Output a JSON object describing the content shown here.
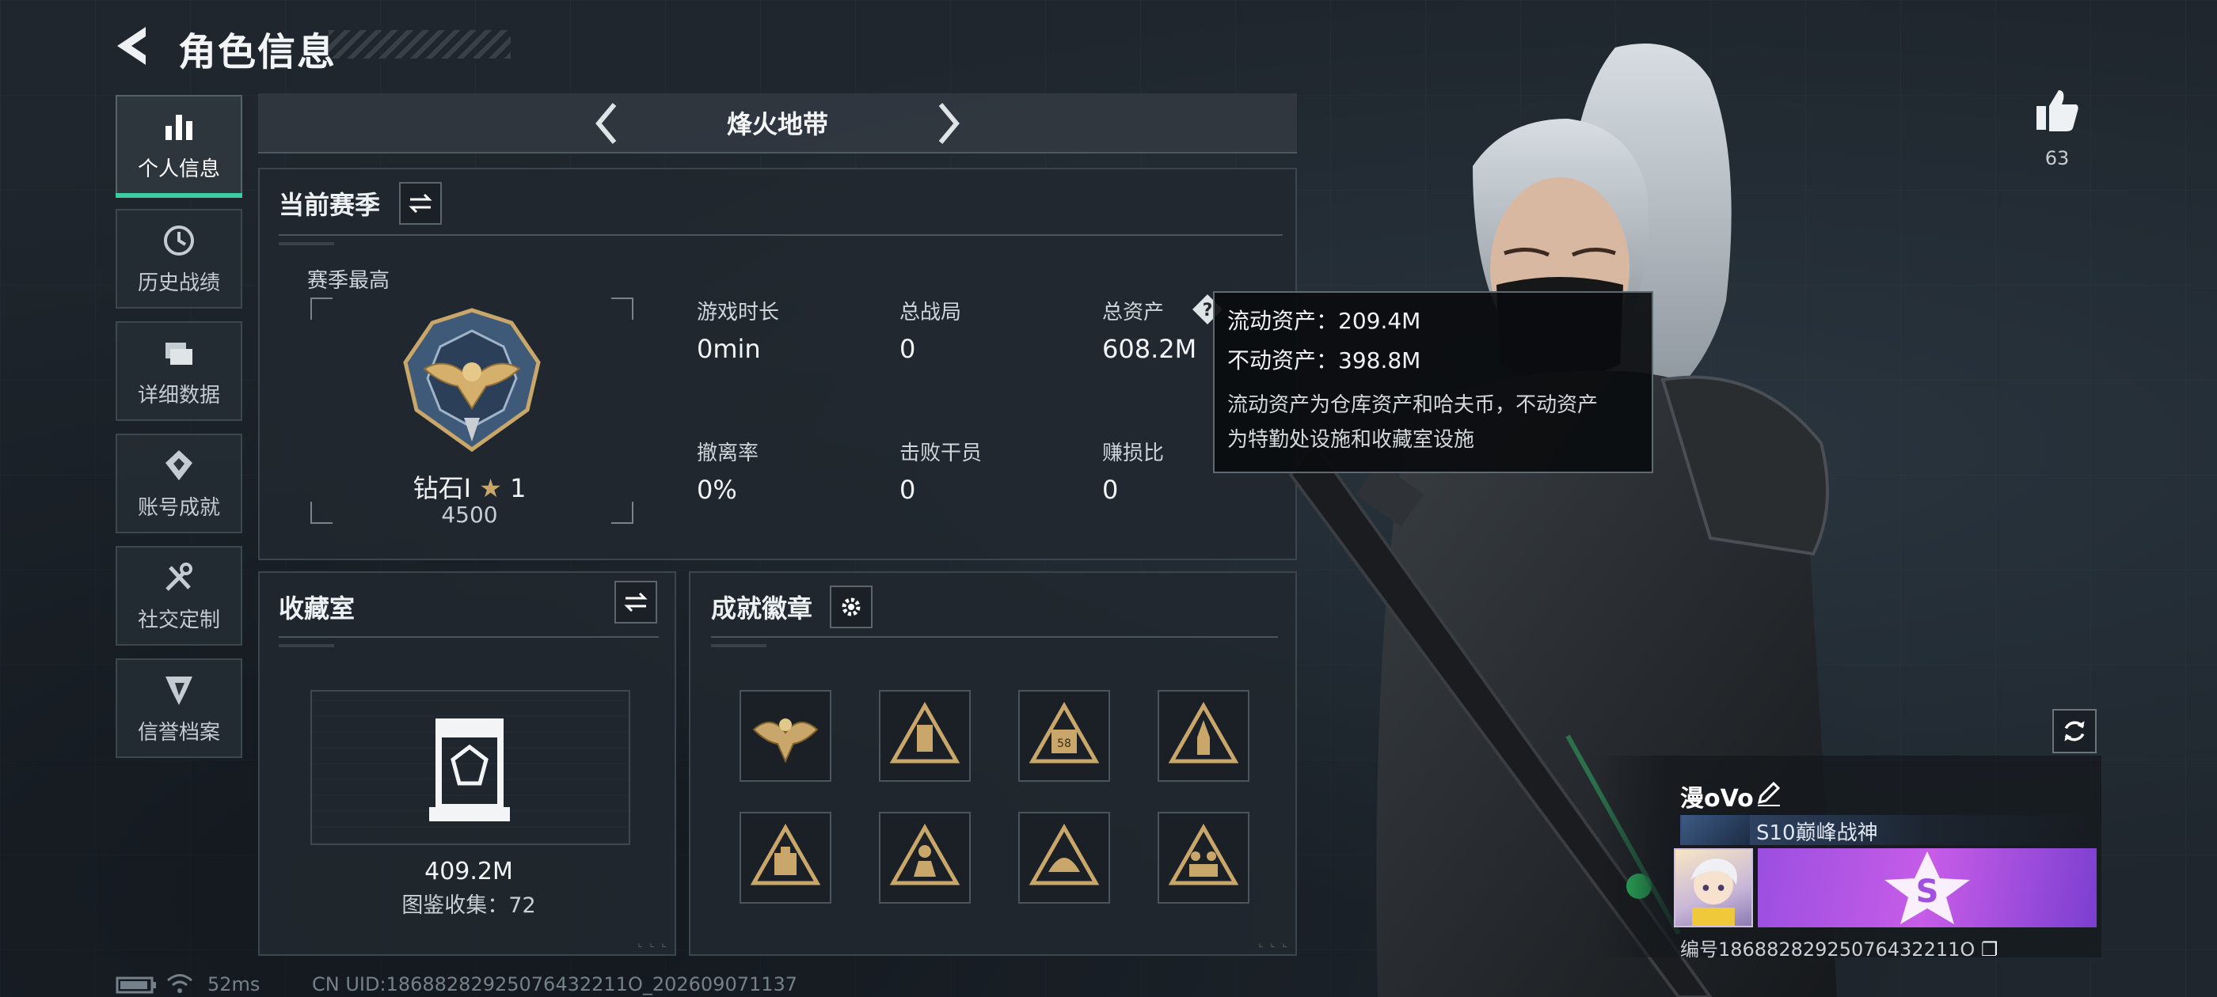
{
  "header": {
    "title": "角色信息"
  },
  "sidebar": {
    "items": [
      {
        "label": "个人信息",
        "icon": "bar-chart-icon",
        "active": true
      },
      {
        "label": "历史战绩",
        "icon": "history-icon",
        "active": false
      },
      {
        "label": "详细数据",
        "icon": "folders-icon",
        "active": false
      },
      {
        "label": "账号成就",
        "icon": "achievement-icon",
        "active": false
      },
      {
        "label": "社交定制",
        "icon": "tools-icon",
        "active": false
      },
      {
        "label": "信誉档案",
        "icon": "credit-icon",
        "active": false
      }
    ]
  },
  "mode": {
    "name": "烽火地带"
  },
  "season": {
    "title": "当前赛季",
    "best_label": "赛季最高",
    "rank_name": "钻石I",
    "rank_stars": "1",
    "rank_points": "4500",
    "stats": [
      {
        "label": "游戏时长",
        "value": "0min"
      },
      {
        "label": "总战局",
        "value": "0"
      },
      {
        "label": "总资产",
        "value": "608.2M"
      },
      {
        "label": "撤离率",
        "value": "0%"
      },
      {
        "label": "击败干员",
        "value": "0"
      },
      {
        "label": "赚损比",
        "value": "0"
      }
    ]
  },
  "tooltip": {
    "liquid": "流动资产：209.4M",
    "fixed": "不动资产：398.8M",
    "desc_1": "流动资产为仓库资产和哈夫币，不动资产",
    "desc_2": "为特勤处设施和收藏室设施"
  },
  "collection": {
    "title": "收藏室",
    "value": "409.2M",
    "count": "图鉴收集：72"
  },
  "badges": {
    "title": "成就徽章",
    "items": [
      "eagle-badge-icon",
      "tower-badge-icon",
      "box-58-badge-icon",
      "rocket-badge-icon",
      "crate-badge-icon",
      "soldier-badge-icon",
      "helmet-badge-icon",
      "squad-badge-icon"
    ]
  },
  "profile": {
    "likes": "63",
    "nickname": "漫oVo",
    "rank_title": "S10巅峰战神",
    "banner_text": "S",
    "id_line": "编号18688282925076432211O"
  },
  "footer": {
    "ping": "52ms",
    "uid": "CN UID:18688282925076432211O_202609071137"
  },
  "colors": {
    "accent": "#3dcca0",
    "gold": "#c9a66a",
    "panel": "#21282f",
    "banner": "#b455e6"
  }
}
